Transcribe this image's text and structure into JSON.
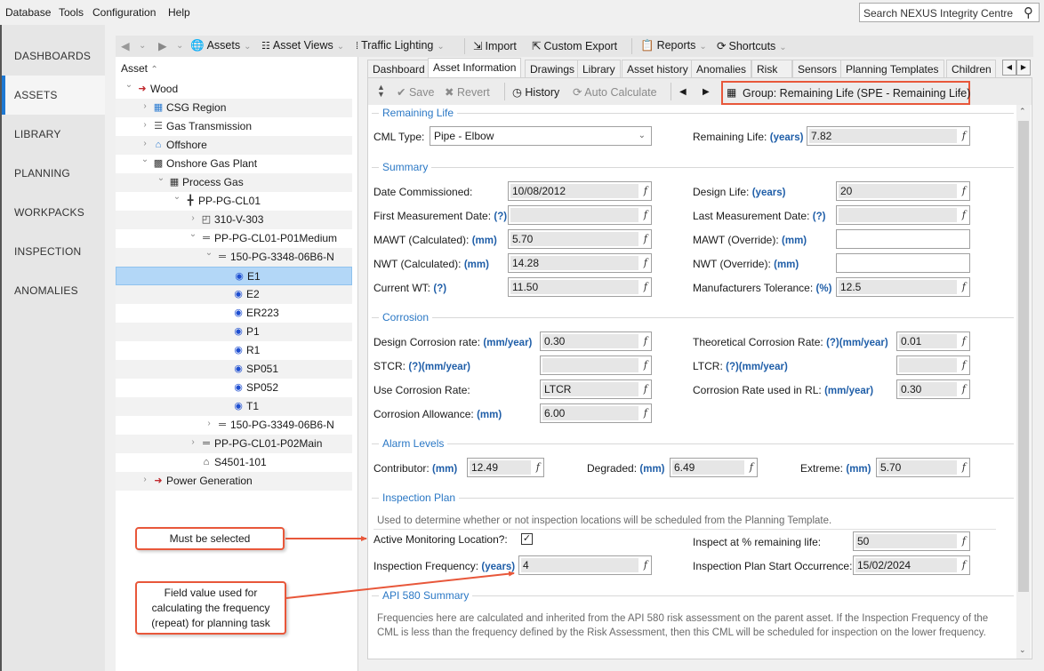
{
  "menubar": {
    "items": [
      "Database",
      "Tools",
      "Configuration",
      "Help"
    ],
    "search_placeholder": "Search NEXUS Integrity Centre"
  },
  "leftnav": {
    "items": [
      {
        "label": "DASHBOARDS",
        "active": false
      },
      {
        "label": "ASSETS",
        "active": true
      },
      {
        "label": "LIBRARY",
        "active": false
      },
      {
        "label": "PLANNING",
        "active": false
      },
      {
        "label": "WORKPACKS",
        "active": false
      },
      {
        "label": "INSPECTION",
        "active": false
      },
      {
        "label": "ANOMALIES",
        "active": false
      }
    ],
    "accent_color": "#1e78d2"
  },
  "toolbar": {
    "assets": "Assets",
    "asset_views": "Asset Views",
    "traffic_lighting": "Traffic Lighting",
    "import": "Import",
    "custom_export": "Custom Export",
    "reports": "Reports",
    "shortcuts": "Shortcuts"
  },
  "tree": {
    "header": "Asset",
    "nodes": [
      {
        "label": "Wood",
        "level": 0,
        "expand": "open",
        "icon": "red-arrow-icon"
      },
      {
        "label": "CSG Region",
        "level": 1,
        "expand": "closed",
        "icon": "region-icon"
      },
      {
        "label": "Gas Transmission",
        "level": 1,
        "expand": "closed",
        "icon": "pipeline-icon"
      },
      {
        "label": "Offshore",
        "level": 1,
        "expand": "closed",
        "icon": "offshore-icon"
      },
      {
        "label": "Onshore Gas Plant",
        "level": 1,
        "expand": "open",
        "icon": "plant-icon"
      },
      {
        "label": "Process Gas",
        "level": 2,
        "expand": "open",
        "icon": "process-icon"
      },
      {
        "label": "PP-PG-CL01",
        "level": 3,
        "expand": "open",
        "icon": "circuit-icon"
      },
      {
        "label": "310-V-303",
        "level": 4,
        "expand": "closed",
        "icon": "vessel-icon"
      },
      {
        "label": "PP-PG-CL01-P01Medium",
        "level": 4,
        "expand": "open",
        "icon": "pipe-icon"
      },
      {
        "label": "150-PG-3348-06B6-N",
        "level": 5,
        "expand": "open",
        "icon": "pipe-icon"
      },
      {
        "label": "E1",
        "level": 6,
        "expand": "none",
        "icon": "cml-icon",
        "selected": true
      },
      {
        "label": "E2",
        "level": 6,
        "expand": "none",
        "icon": "cml-icon"
      },
      {
        "label": "ER223",
        "level": 6,
        "expand": "none",
        "icon": "cml-icon"
      },
      {
        "label": "P1",
        "level": 6,
        "expand": "none",
        "icon": "cml-icon"
      },
      {
        "label": "R1",
        "level": 6,
        "expand": "none",
        "icon": "cml-icon"
      },
      {
        "label": "SP051",
        "level": 6,
        "expand": "none",
        "icon": "cml-icon"
      },
      {
        "label": "SP052",
        "level": 6,
        "expand": "none",
        "icon": "cml-icon"
      },
      {
        "label": "T1",
        "level": 6,
        "expand": "none",
        "icon": "cml-icon"
      },
      {
        "label": "150-PG-3349-06B6-N",
        "level": 5,
        "expand": "closed",
        "icon": "pipe-icon"
      },
      {
        "label": "PP-PG-CL01-P02Main",
        "level": 4,
        "expand": "closed",
        "icon": "pipe-icon"
      },
      {
        "label": "S4501-101",
        "level": 4,
        "expand": "none",
        "icon": "valve-icon"
      },
      {
        "label": "Power Generation",
        "level": 1,
        "expand": "closed",
        "icon": "red-arrow-icon"
      }
    ]
  },
  "tabs": [
    {
      "label": "Dashboard",
      "active": false
    },
    {
      "label": "Asset Information",
      "active": true
    },
    {
      "label": "Drawings",
      "active": false
    },
    {
      "label": "Library",
      "active": false
    },
    {
      "label": "Asset history",
      "active": false
    },
    {
      "label": "Anomalies",
      "active": false
    },
    {
      "label": "Risk",
      "active": false
    },
    {
      "label": "Sensors",
      "active": false
    },
    {
      "label": "Planning Templates",
      "active": false
    },
    {
      "label": "Children",
      "active": false
    }
  ],
  "detail_toolbar": {
    "save": "Save",
    "revert": "Revert",
    "history": "History",
    "auto_calculate": "Auto Calculate",
    "group": "Group: Remaining Life (SPE - Remaining Life)"
  },
  "form": {
    "remaining_life": {
      "title": "Remaining Life",
      "cml_type_label": "CML Type:",
      "cml_type_value": "Pipe - Elbow",
      "remaining_life_label": "Remaining Life:",
      "remaining_life_unit": "(years)",
      "remaining_life_value": "7.82"
    },
    "summary": {
      "title": "Summary",
      "date_commissioned_label": "Date Commissioned:",
      "date_commissioned_value": "10/08/2012",
      "first_meas_label": "First Measurement Date:",
      "first_meas_unit": "(?)",
      "first_meas_value": "",
      "mawt_calc_label": "MAWT (Calculated):",
      "mawt_calc_unit": "(mm)",
      "mawt_calc_value": "5.70",
      "nwt_calc_label": "NWT (Calculated):",
      "nwt_calc_unit": "(mm)",
      "nwt_calc_value": "14.28",
      "current_wt_label": "Current WT:",
      "current_wt_unit": "(?)",
      "current_wt_value": "11.50",
      "design_life_label": "Design Life:",
      "design_life_unit": "(years)",
      "design_life_value": "20",
      "last_meas_label": "Last Measurement Date:",
      "last_meas_unit": "(?)",
      "last_meas_value": "",
      "mawt_override_label": "MAWT (Override):",
      "mawt_override_unit": "(mm)",
      "mawt_override_value": "",
      "nwt_override_label": "NWT (Override):",
      "nwt_override_unit": "(mm)",
      "nwt_override_value": "",
      "mfr_tol_label": "Manufacturers Tolerance:",
      "mfr_tol_unit": "(%)",
      "mfr_tol_value": "12.5"
    },
    "corrosion": {
      "title": "Corrosion",
      "design_rate_label": "Design Corrosion rate:",
      "design_rate_unit": "(mm/year)",
      "design_rate_value": "0.30",
      "stcr_label": "STCR:",
      "stcr_unit": "(?)(mm/year)",
      "stcr_value": "",
      "use_rate_label": "Use Corrosion Rate:",
      "use_rate_value": "LTCR",
      "allowance_label": "Corrosion Allowance:",
      "allowance_unit": "(mm)",
      "allowance_value": "6.00",
      "theoretical_label": "Theoretical Corrosion Rate:",
      "theoretical_unit": "(?)(mm/year)",
      "theoretical_value": "0.01",
      "ltcr_label": "LTCR:",
      "ltcr_unit": "(?)(mm/year)",
      "ltcr_value": "",
      "rate_in_rl_label": "Corrosion Rate used in RL:",
      "rate_in_rl_unit": "(mm/year)",
      "rate_in_rl_value": "0.30"
    },
    "alarm": {
      "title": "Alarm Levels",
      "contributor_label": "Contributor:",
      "contributor_unit": "(mm)",
      "contributor_value": "12.49",
      "degraded_label": "Degraded:",
      "degraded_unit": "(mm)",
      "degraded_value": "6.49",
      "extreme_label": "Extreme:",
      "extreme_unit": "(mm)",
      "extreme_value": "5.70"
    },
    "inspection_plan": {
      "title": "Inspection Plan",
      "description": "Used to determine whether or not inspection locations will be scheduled from the Planning Template.",
      "active_label": "Active Monitoring Location?:",
      "active_checked": true,
      "frequency_label": "Inspection Frequency:",
      "frequency_unit": "(years)",
      "frequency_value": "4",
      "inspect_pct_label": "Inspect at % remaining life:",
      "inspect_pct_value": "50",
      "start_label": "Inspection Plan Start Occurrence:",
      "start_value": "15/02/2024"
    },
    "api580": {
      "title": "API 580 Summary",
      "line1": "Frequencies here are calculated and inherited from the API 580 risk assessment on the parent asset.  If the Inspection Frequency of the",
      "line2": "CML is less than the frequency defined by the Risk Assessment, then this CML will be scheduled for inspection on the lower frequency."
    }
  },
  "callouts": {
    "must_select": "Must be selected",
    "field_value_1": "Field value used for",
    "field_value_2": "calculating the frequency",
    "field_value_3": "(repeat) for planning task",
    "color": "#e8573a"
  }
}
